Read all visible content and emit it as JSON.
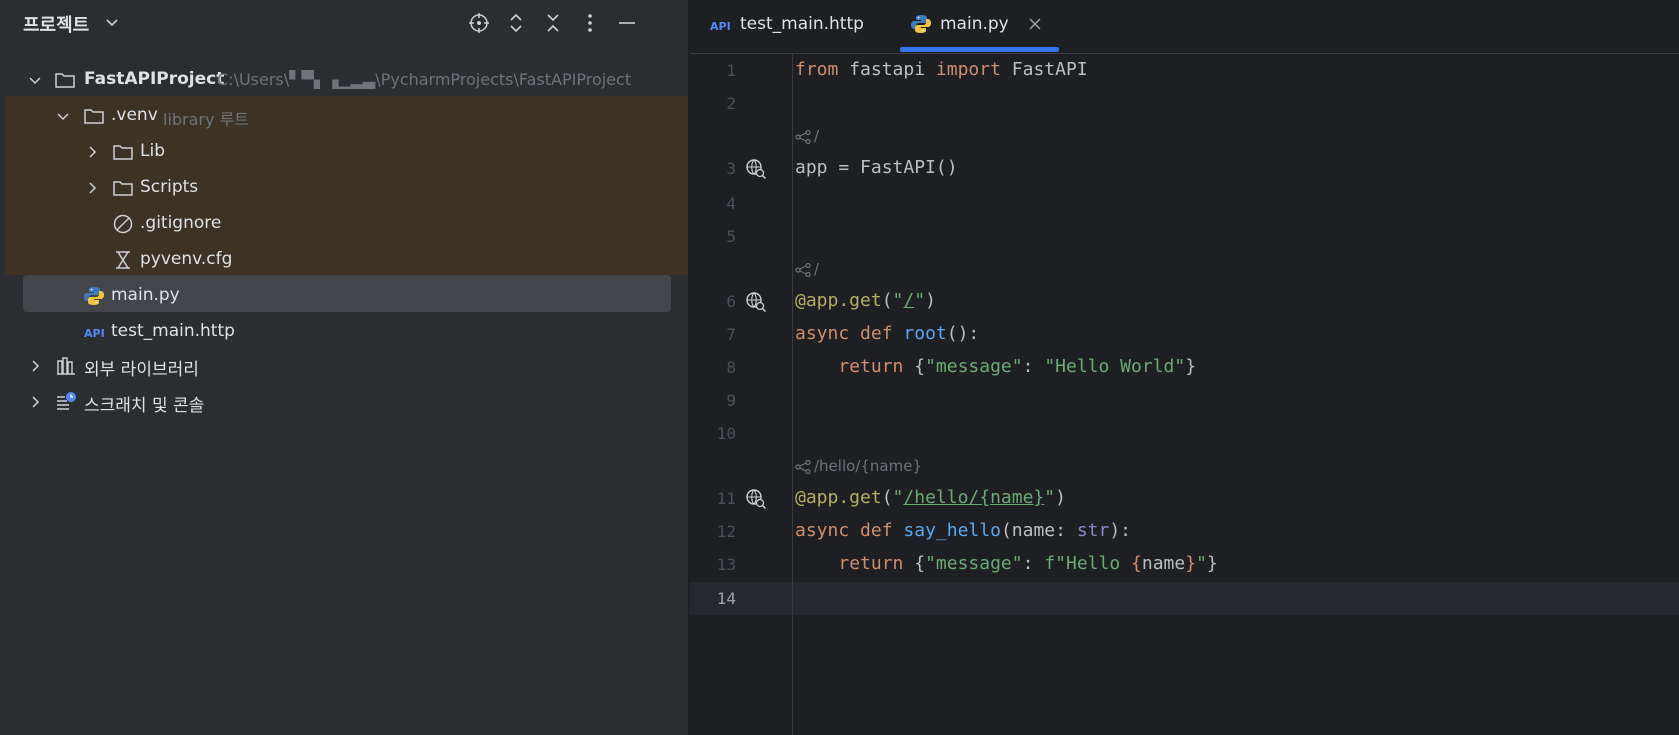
{
  "panel": {
    "title": "프로젝트",
    "tree": {
      "root": {
        "name": "FastAPIProject",
        "path": "C:\\Users\\▘▀▖▗▁▂▃\\PycharmProjects\\FastAPIProject"
      },
      "venv": {
        "name": ".venv",
        "meta": "library 루트"
      },
      "lib": "Lib",
      "scripts": "Scripts",
      "gitignore": ".gitignore",
      "pyvenv": "pyvenv.cfg",
      "main": "main.py",
      "test_http": "test_main.http",
      "external_libs": "외부 라이브러리",
      "scratches": "스크래치 및 콘솔"
    }
  },
  "tabs": [
    {
      "label": "test_main.http",
      "icon": "api-icon",
      "active": false
    },
    {
      "label": "main.py",
      "icon": "python-icon",
      "active": true
    }
  ],
  "editor": {
    "lines": [
      {
        "n": "1"
      },
      {
        "n": "2"
      },
      {
        "n": "3"
      },
      {
        "n": "4"
      },
      {
        "n": "5"
      },
      {
        "n": "6"
      },
      {
        "n": "7"
      },
      {
        "n": "8"
      },
      {
        "n": "9"
      },
      {
        "n": "10"
      },
      {
        "n": "11"
      },
      {
        "n": "12"
      },
      {
        "n": "13"
      },
      {
        "n": "14"
      }
    ],
    "inlay1": "/",
    "inlay2": "/",
    "inlay3": "/hello/{name}",
    "code": {
      "l1_from": "from",
      "l1_mod": "fastapi",
      "l1_import": "import",
      "l1_cls": "FastAPI",
      "l3": "app = FastAPI()",
      "l6_deco": "@app.get",
      "l6_path": "/",
      "l7_async": "async",
      "l7_def": "def",
      "l7_fn": "root",
      "l7_rest": "():",
      "l8_return": "return",
      "l8_key": "\"message\"",
      "l8_val": "\"Hello World\"",
      "l11_deco": "@app.get",
      "l11_path": "/hello/{name}",
      "l12_async": "async",
      "l12_def": "def",
      "l12_fn": "say_hello",
      "l12_param": "name",
      "l12_type": "str",
      "l13_return": "return",
      "l13_key": "\"message\"",
      "l13_f": "f\"Hello ",
      "l13_var": "name",
      "l13_end": "\""
    }
  },
  "colors": {
    "panel_bg": "#2b2d30",
    "editor_bg": "#1e1f22",
    "venv_highlight": "#3d3224",
    "selection": "#43454a",
    "accent": "#3574f0",
    "keyword": "#cf8e6d",
    "string": "#6aab73",
    "function": "#56a8f5",
    "decorator": "#b3ae60"
  }
}
